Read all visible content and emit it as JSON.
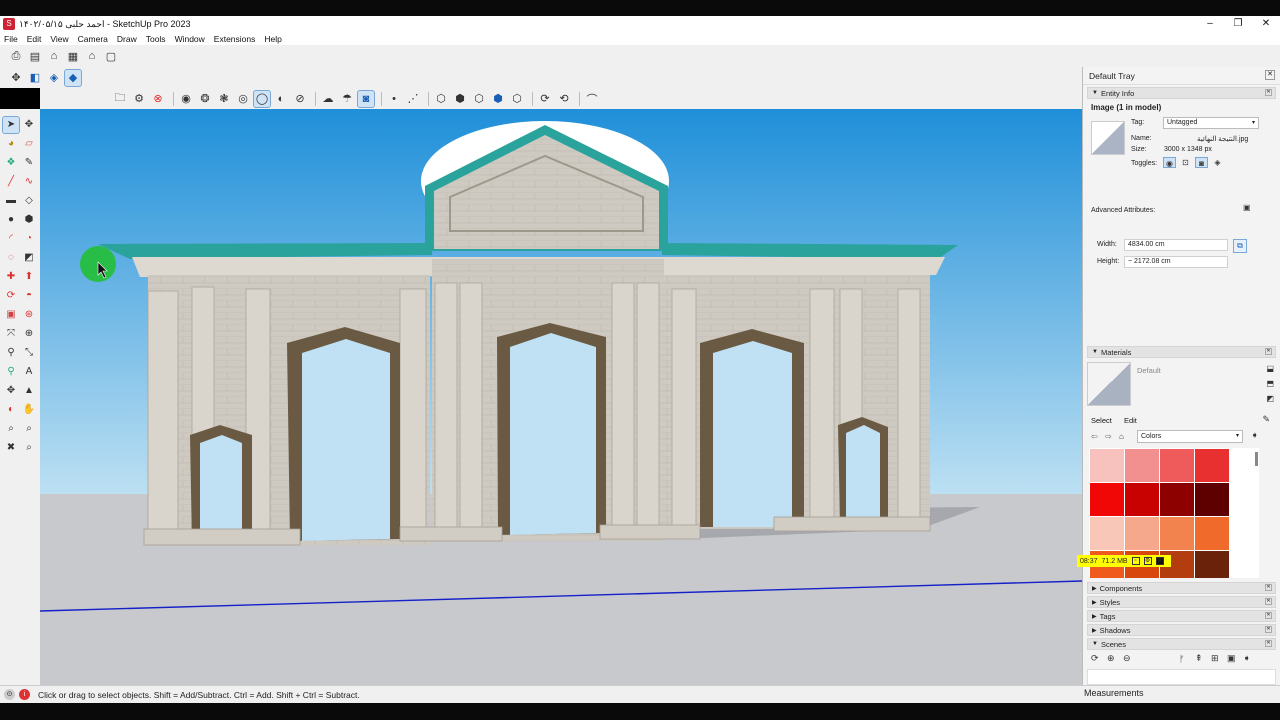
{
  "window": {
    "title": "احمد حلبی ۱۴۰۲/۰۵/۱۵ - SketchUp Pro 2023",
    "controls": [
      "–",
      "❐",
      "✕"
    ]
  },
  "menu": [
    "File",
    "Edit",
    "View",
    "Camera",
    "Draw",
    "Tools",
    "Window",
    "Extensions",
    "Help"
  ],
  "toolbar_icons": {
    "row1": [
      "open-icon",
      "save-icon",
      "home-icon",
      "warehouse-icon",
      "house-icon",
      "window-icon"
    ],
    "row2": [
      "move-view-icon",
      "top-view-icon",
      "iso-view-icon",
      "front-view-icon"
    ],
    "row3": [
      "folder-icon",
      "gear-icon",
      "cancel-icon",
      "styles-icon",
      "layers-icon",
      "layers-alt-icon",
      "xray-icon",
      "back-edges-icon",
      "wireframe-icon",
      "hidden-line-icon",
      "shaded-icon",
      "textured-icon",
      "monochrome-icon",
      "section-icon",
      "fog-icon",
      "dot-icon",
      "measure-icon",
      "sandbox-icon",
      "sandbox-alt-icon",
      "stamp-icon",
      "drape-icon",
      "smoove-icon",
      "flip-icon",
      "add-detail-icon",
      "arc-tool-icon"
    ]
  },
  "left_tools": [
    "select-icon",
    "pan-icon",
    "paint-icon",
    "eraser-icon",
    "component-icon",
    "pencil-icon",
    "line-icon",
    "freehand-icon",
    "rectangle-icon",
    "rotated-rect-icon",
    "circle-icon",
    "polygon-icon",
    "arc-icon",
    "pie-icon",
    "offset-icon",
    "rotate-icon",
    "move-icon",
    "push-pull-icon",
    "scale-icon",
    "follow-me-icon",
    "tape-icon",
    "dimension-icon",
    "protractor-icon",
    "text-icon",
    "axes-icon",
    "3d-text-icon",
    "orbit-icon",
    "look-around-icon",
    "zoom-icon",
    "zoom-window-icon",
    "zoom-extents-icon",
    "walk-icon",
    "position-camera-icon",
    "section-plane-icon",
    "layers-tool-icon",
    "outliner-icon"
  ],
  "status": {
    "text": "Click or drag to select objects. Shift = Add/Subtract. Ctrl = Add. Shift + Ctrl = Subtract.",
    "measurements_label": "Measurements"
  },
  "tray": {
    "title": "Default Tray",
    "entity_info": {
      "header": "Entity Info",
      "heading": "Image (1 in model)",
      "tag_label": "Tag:",
      "tag_value": "Untagged",
      "name_label": "Name:",
      "name_value": "النتیجة النهائية.jpg",
      "size_label": "Size:",
      "size_value": "3000 x 1348 px",
      "toggles_label": "Toggles:",
      "advanced_label": "Advanced Attributes:",
      "width_label": "Width:",
      "width_value": "4834.00 cm",
      "height_label": "Height:",
      "height_value": "~ 2172.08 cm"
    },
    "materials": {
      "header": "Materials",
      "name": "Default",
      "tab_select": "Select",
      "tab_edit": "Edit",
      "collection": "Colors",
      "swatches": [
        "#f7c1bd",
        "#f28f8f",
        "#ef5b5b",
        "#e93030",
        "#f20707",
        "#c80101",
        "#8e0101",
        "#5f0000",
        "#f8c7b7",
        "#f5a88b",
        "#f3834e",
        "#f06a2c",
        "#f05a1c",
        "#d8480d",
        "#b33d0e",
        "#6b220a"
      ]
    },
    "memory": {
      "time": "08:37",
      "mem": "71.2 MB"
    },
    "collapsed_panels": [
      "Components",
      "Styles",
      "Tags",
      "Shadows"
    ],
    "scenes": {
      "header": "Scenes"
    }
  },
  "colors": {
    "sky_top": "#1f8fd9",
    "sky_bottom": "#bfe1f3",
    "ground": "#c8c9cd",
    "cornice": "#2aa39c",
    "stone": "#cfcac1",
    "arch_shadow": "#6b5a43",
    "axis_blue": "#1420c8"
  }
}
